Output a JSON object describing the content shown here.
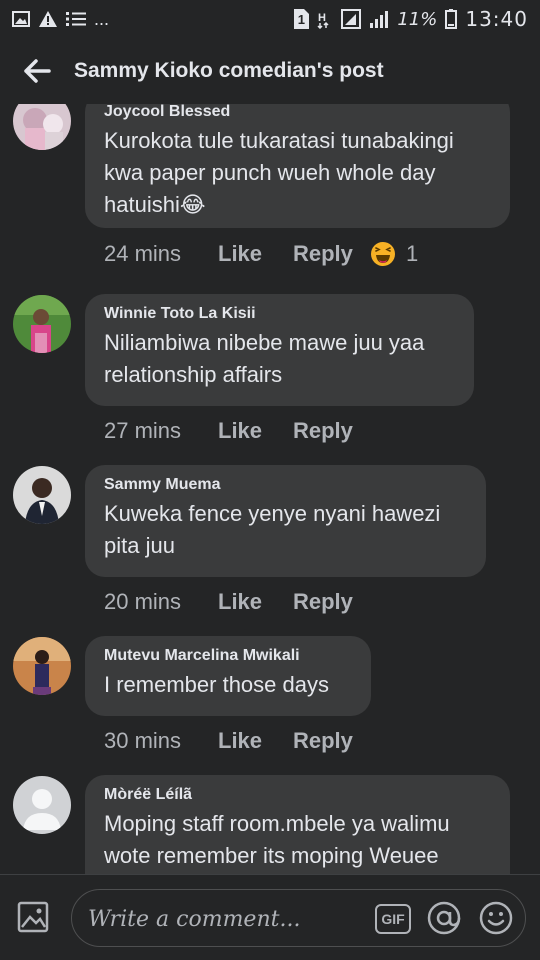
{
  "status_bar": {
    "more": "...",
    "sim_badge": "1",
    "battery_percent": "11%",
    "time": "13:40",
    "icons": [
      "image-icon",
      "warning-icon",
      "list-icon",
      "sim-icon",
      "h-signal-icon",
      "nfc-icon",
      "signal-icon",
      "battery-icon"
    ]
  },
  "header": {
    "title": "Sammy Kioko comedian's post",
    "back_icon": "arrow-left-icon"
  },
  "comments": [
    {
      "author": "Joycool Blessed",
      "text": "Kurokota tule tukaratasi tunabakingi kwa paper punch wueh whole day hatuishi😂",
      "time": "24 mins",
      "like": "Like",
      "reply": "Reply",
      "reaction": {
        "emoji": "haha",
        "count": "1"
      }
    },
    {
      "author": "Winnie Toto La Kisii",
      "text": "Niliambiwa nibebe mawe juu yaa relationship affairs",
      "time": "27 mins",
      "like": "Like",
      "reply": "Reply"
    },
    {
      "author": "Sammy Muema",
      "text": "Kuweka fence yenye nyani hawezi pita juu",
      "time": "20 mins",
      "like": "Like",
      "reply": "Reply"
    },
    {
      "author": "Mutevu Marcelina Mwikali",
      "text": "I remember those days",
      "time": "30 mins",
      "like": "Like",
      "reply": "Reply"
    },
    {
      "author": "Mòréë Léílã",
      "text": "Moping staff room.mbele ya walimu wote remember its moping Weuee",
      "time": "",
      "like": "",
      "reply": ""
    }
  ],
  "composer": {
    "placeholder": "Write a comment...",
    "gif_label": "GIF",
    "icons": [
      "photo-icon",
      "at-icon",
      "emoji-icon"
    ]
  },
  "colors": {
    "background": "#242526",
    "bubble": "#3a3b3c",
    "text": "#e4e6eb",
    "muted": "#b0b3b8"
  }
}
